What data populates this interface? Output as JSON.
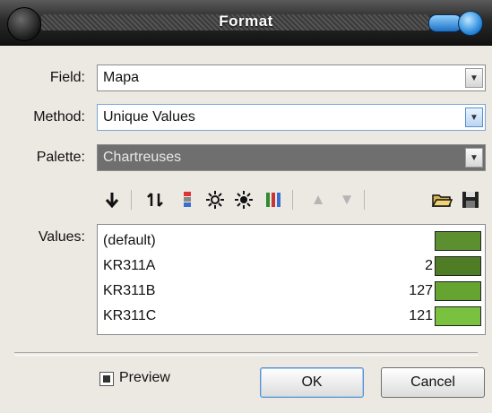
{
  "window": {
    "title": "Format"
  },
  "form": {
    "field_label": "Field:",
    "field_value": "Mapa",
    "method_label": "Method:",
    "method_value": "Unique Values",
    "palette_label": "Palette:",
    "palette_value": "Chartreuses",
    "values_label": "Values:"
  },
  "toolbar": {
    "icons": [
      "arrow-down-icon",
      "refresh-icon",
      "color-ramp-icon",
      "sun-plus-icon",
      "sun-minus-icon",
      "palette-bars-icon",
      "move-up-icon",
      "move-down-icon",
      "open-folder-icon",
      "save-icon"
    ]
  },
  "values": [
    {
      "name": "(default)",
      "count": "",
      "color": "#5b8f30"
    },
    {
      "name": "KR311A",
      "count": "2",
      "color": "#4f7d25"
    },
    {
      "name": "KR311B",
      "count": "127",
      "color": "#66a432"
    },
    {
      "name": "KR311C",
      "count": "121",
      "color": "#79c13e"
    }
  ],
  "footer": {
    "preview_label": "Preview",
    "preview_checked": true,
    "ok_label": "OK",
    "cancel_label": "Cancel"
  }
}
